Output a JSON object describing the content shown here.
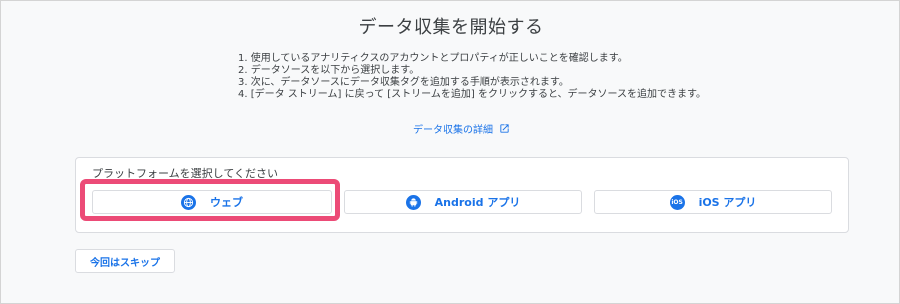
{
  "page": {
    "title": "データ収集を開始する",
    "steps": [
      "1. 使用しているアナリティクスのアカウントとプロパティが正しいことを確認します。",
      "2. データソースを以下から選択します。",
      "3. 次に、データソースにデータ収集タグを追加する手順が表示されます。",
      "4. [データ ストリーム] に戻って [ストリームを追加] をクリックすると、データソースを追加できます。"
    ],
    "details_link": "データ収集の詳細",
    "details_icon": "open-in-new-icon"
  },
  "platform_panel": {
    "label": "プラットフォームを選択してください",
    "buttons": [
      {
        "label": "ウェブ",
        "icon": "globe-icon"
      },
      {
        "label": "Android アプリ",
        "icon": "android-icon"
      },
      {
        "label": "iOS アプリ",
        "icon": "ios-icon",
        "icon_text": "iOS"
      }
    ],
    "highlight_color": "#ec4b77"
  },
  "skip_button": {
    "label": "今回はスキップ"
  },
  "colors": {
    "accent": "#1a73e8",
    "text": "#3c4043",
    "border": "#dadce0"
  }
}
